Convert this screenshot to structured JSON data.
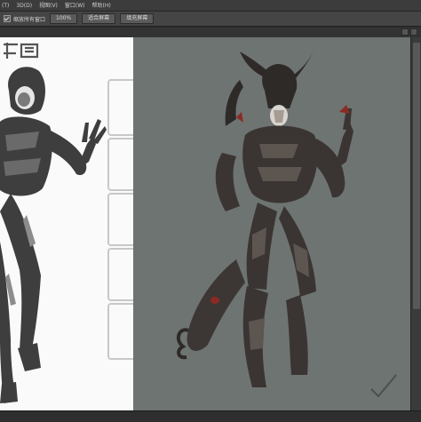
{
  "menubar": {
    "items": [
      "(T)",
      "3D(D)",
      "视图(V)",
      "窗口(W)",
      "帮助(H)"
    ]
  },
  "options_bar": {
    "checkbox_label": "缩放所有窗口",
    "buttons": [
      "100%",
      "适合屏幕",
      "填充屏幕"
    ]
  },
  "canvas": {
    "left_bg": "#fafafa",
    "right_bg": "#6e7472",
    "figures": [
      {
        "name": "sketch-character-grayscale",
        "style": "grayscale"
      },
      {
        "name": "color-character-armored",
        "style": "dark armor with red accents"
      }
    ],
    "thumbnail_frames": 5
  }
}
